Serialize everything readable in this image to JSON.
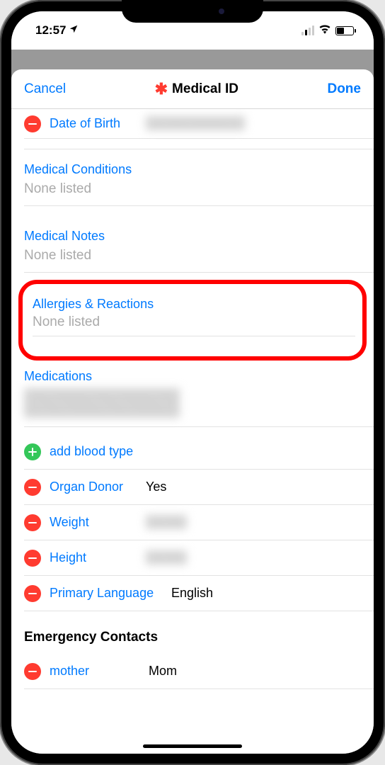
{
  "status": {
    "time": "12:57"
  },
  "nav": {
    "cancel": "Cancel",
    "title": "Medical ID",
    "done": "Done"
  },
  "fields": {
    "dob_label": "Date of Birth",
    "conditions_label": "Medical Conditions",
    "conditions_value": "None listed",
    "notes_label": "Medical Notes",
    "notes_value": "None listed",
    "allergies_label": "Allergies & Reactions",
    "allergies_value": "None listed",
    "medications_label": "Medications",
    "add_blood_type": "add blood type",
    "organ_donor_label": "Organ Donor",
    "organ_donor_value": "Yes",
    "weight_label": "Weight",
    "height_label": "Height",
    "primary_lang_label": "Primary Language",
    "primary_lang_value": "English"
  },
  "emergency": {
    "header": "Emergency Contacts",
    "contact1_relation": "mother",
    "contact1_name": "Mom"
  }
}
